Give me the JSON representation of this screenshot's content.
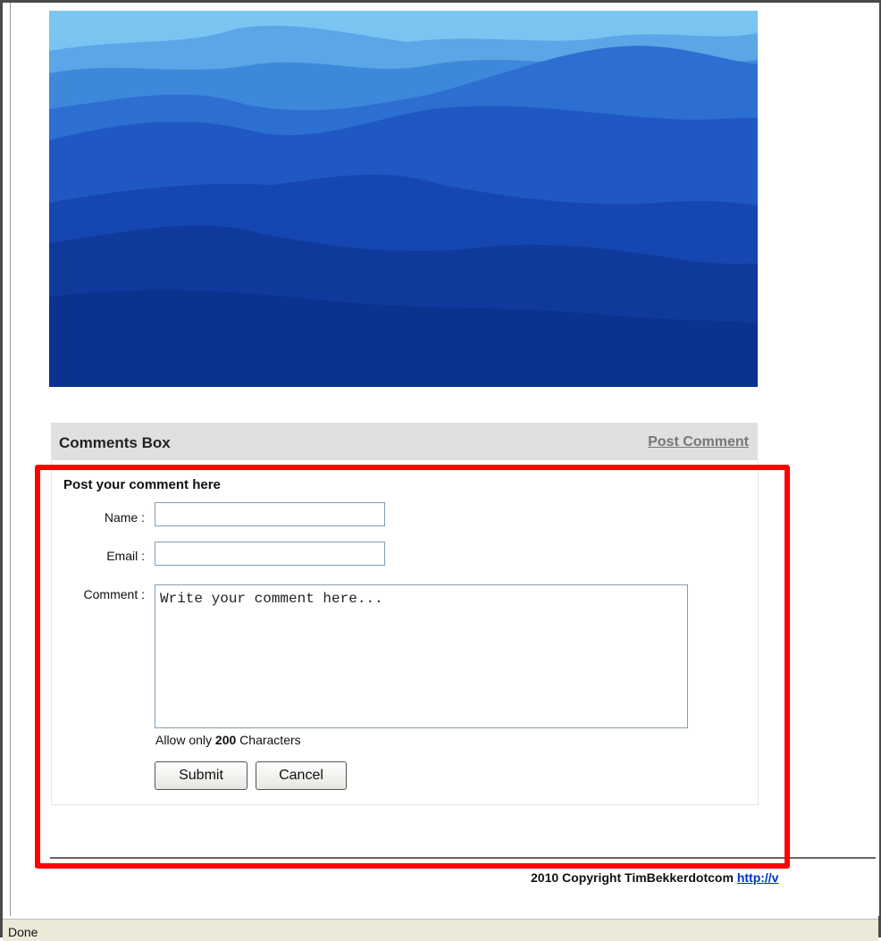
{
  "comments": {
    "title": "Comments Box",
    "post_link": "Post Comment"
  },
  "form": {
    "heading": "Post your comment here",
    "name_label": "Name :",
    "email_label": "Email :",
    "comment_label": "Comment :",
    "name_value": "",
    "email_value": "",
    "comment_value": "Write your comment here...",
    "limit_prefix": "Allow only",
    "limit_value": "200",
    "limit_suffix": "Characters",
    "submit_label": "Submit",
    "cancel_label": "Cancel"
  },
  "footer": {
    "copyright": "2010 Copyright TimBekkerdotcom",
    "link": "http://v"
  },
  "status": {
    "text": "Done"
  },
  "colors": {
    "highlight": "#ff0000",
    "header_bg": "#e0e0e0",
    "link": "#0033cc"
  },
  "icons": []
}
